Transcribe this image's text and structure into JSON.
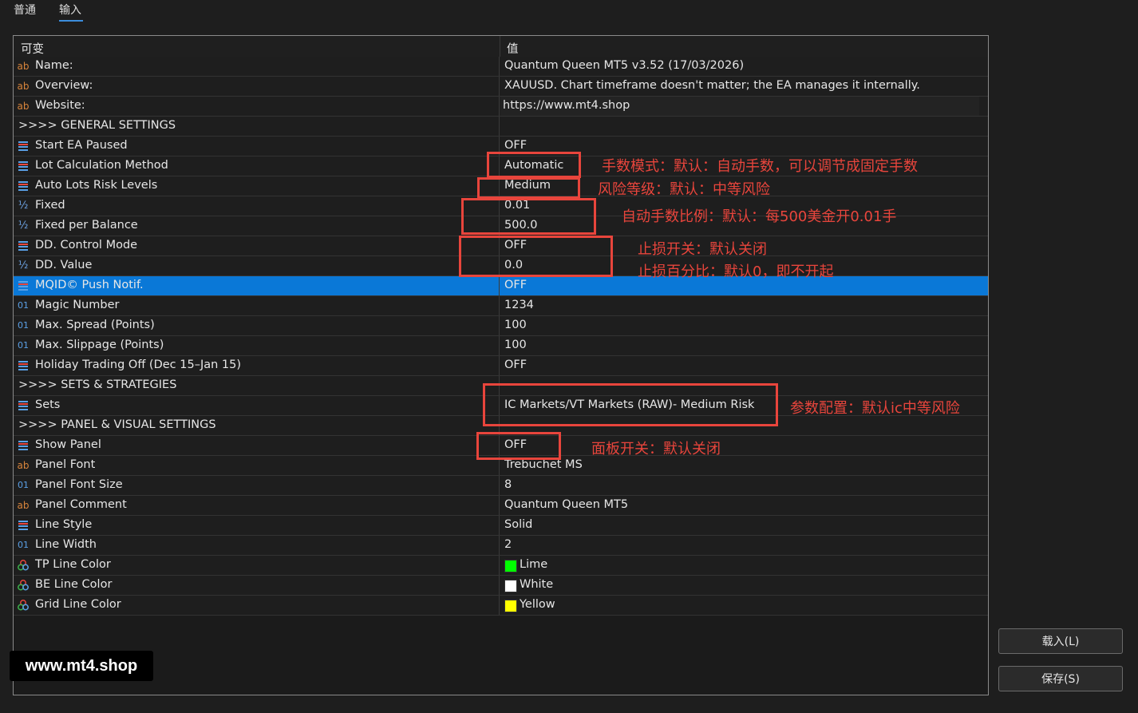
{
  "tabs": [
    {
      "label": "普通"
    },
    {
      "label": "输入"
    }
  ],
  "table": {
    "col_variable": "可变",
    "col_value": "值",
    "rows": [
      {
        "icon": "ab",
        "name": "Name:",
        "value": "Quantum Queen MT5 v3.52 (17/03/2026)"
      },
      {
        "icon": "ab",
        "name": "Overview:",
        "value": "XAUUSD. Chart timeframe doesn't matter; the EA manages it internally."
      },
      {
        "icon": "ab",
        "name": "Website:",
        "value": "https://www.mt4.shop"
      },
      {
        "icon": "",
        "name": ">>>> GENERAL SETTINGS",
        "value": ""
      },
      {
        "icon": "enum",
        "name": "Start EA Paused",
        "value": "OFF"
      },
      {
        "icon": "enum",
        "name": "Lot Calculation Method",
        "value": "Automatic"
      },
      {
        "icon": "enum",
        "name": "Auto Lots Risk Levels",
        "value": "Medium"
      },
      {
        "icon": "half",
        "name": "Fixed",
        "value": "0.01"
      },
      {
        "icon": "half",
        "name": "Fixed per Balance",
        "value": "500.0"
      },
      {
        "icon": "enum",
        "name": "DD. Control Mode",
        "value": "OFF"
      },
      {
        "icon": "half",
        "name": "DD. Value",
        "value": "0.0"
      },
      {
        "icon": "enum",
        "name": "MQID© Push Notif.",
        "value": "OFF"
      },
      {
        "icon": "01",
        "name": "Magic Number",
        "value": "1234"
      },
      {
        "icon": "01",
        "name": "Max. Spread (Points)",
        "value": "100"
      },
      {
        "icon": "01",
        "name": "Max. Slippage (Points)",
        "value": "100"
      },
      {
        "icon": "enum",
        "name": "Holiday Trading Off (Dec 15–Jan 15)",
        "value": "OFF"
      },
      {
        "icon": "",
        "name": ">>>> SETS & STRATEGIES",
        "value": ""
      },
      {
        "icon": "enum",
        "name": "Sets",
        "value": "IC Markets/VT Markets (RAW)- Medium Risk"
      },
      {
        "icon": "",
        "name": ">>>> PANEL & VISUAL SETTINGS",
        "value": ""
      },
      {
        "icon": "enum",
        "name": "Show Panel",
        "value": "OFF"
      },
      {
        "icon": "ab",
        "name": "Panel Font",
        "value": "Trebuchet MS"
      },
      {
        "icon": "01",
        "name": "Panel Font Size",
        "value": "8"
      },
      {
        "icon": "ab",
        "name": "Panel Comment",
        "value": "Quantum Queen MT5"
      },
      {
        "icon": "enum",
        "name": "Line Style",
        "value": "Solid"
      },
      {
        "icon": "01",
        "name": "Line Width",
        "value": "2"
      },
      {
        "icon": "color",
        "name": "TP Line Color",
        "value": "Lime",
        "swatch": "#00ff00"
      },
      {
        "icon": "color",
        "name": "BE Line Color",
        "value": "White",
        "swatch": "#ffffff"
      },
      {
        "icon": "color",
        "name": "Grid Line Color",
        "value": "Yellow",
        "swatch": "#ffff00"
      }
    ]
  },
  "icon_labels": {
    "ab": "ab",
    "01": "01",
    "half": "½"
  },
  "annotations": [
    "手数模式：默认：自动手数，可以调节成固定手数",
    "风险等级：默认：中等风险",
    "自动手数比例：默认：每500美金开0.01手",
    "止损开关：默认关闭",
    "止损百分比：默认0，即不开起",
    "参数配置：默认ic中等风险",
    "面板开关：默认关闭"
  ],
  "watermark": "www.mt4.shop",
  "buttons": {
    "load": "载入(L)",
    "save": "保存(S)"
  },
  "colors": {
    "selection": "#0a78d7",
    "annotation_red": "#e8453c",
    "tab_underline": "#3c8ddc"
  }
}
